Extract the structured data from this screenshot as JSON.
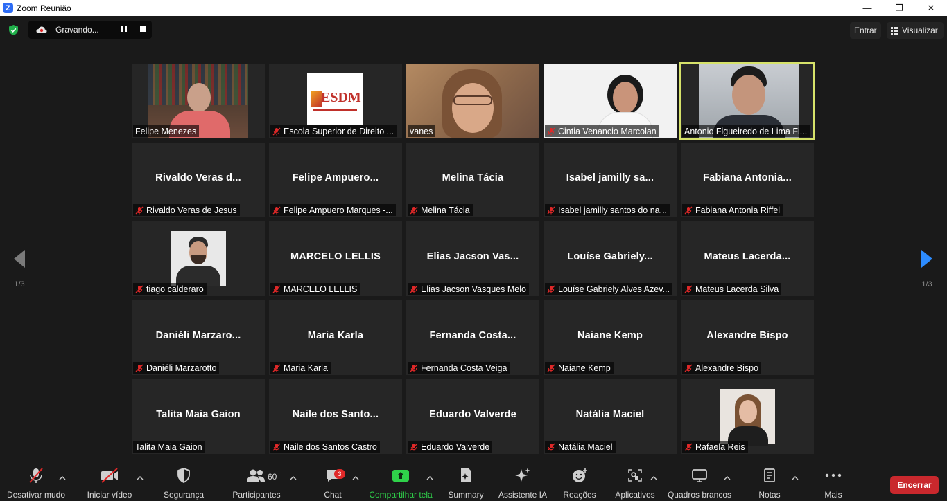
{
  "window": {
    "title": "Zoom Reunião",
    "minimize": "—",
    "restore": "❐",
    "close": "✕"
  },
  "topbar": {
    "recording_label": "Gravando...",
    "enter_label": "Entrar",
    "view_label": "Visualizar"
  },
  "pagination": {
    "left": "1/3",
    "right": "1/3"
  },
  "tiles": [
    {
      "label": "Felipe Menezes",
      "muted": false,
      "video": "felipe"
    },
    {
      "label": "Escola Superior de Direito ...",
      "muted": true,
      "video": "esdm"
    },
    {
      "label": "vanes",
      "muted": false,
      "video": "vanes"
    },
    {
      "label": "Cintia Venancio Marcolan",
      "muted": true,
      "video": "cintia"
    },
    {
      "label": "Antonio Figueiredo de Lima Fi...",
      "muted": false,
      "video": "antonio",
      "active": true
    },
    {
      "label": "Rivaldo Veras de Jesus",
      "big": "Rivaldo  Veras  d...",
      "muted": true
    },
    {
      "label": "Felipe Ampuero Marques -...",
      "big": "Felipe  Ampuero...",
      "muted": true
    },
    {
      "label": "Melina Tácia",
      "big": "Melina Tácia",
      "muted": true
    },
    {
      "label": "Isabel jamilly santos do na...",
      "big": "Isabel  jamilly  sa...",
      "muted": true
    },
    {
      "label": "Fabiana Antonia Riffel",
      "big": "Fabiana  Antonia...",
      "muted": true
    },
    {
      "label": "tiago calderaro",
      "muted": true,
      "video": "tiago"
    },
    {
      "label": "MARCELO LELLIS",
      "big": "MARCELO LELLIS",
      "muted": true
    },
    {
      "label": "Elias Jacson Vasques Melo",
      "big": "Elias  Jacson  Vas...",
      "muted": true
    },
    {
      "label": "Louíse Gabriely Alves Azev...",
      "big": "Louíse  Gabriely...",
      "muted": true
    },
    {
      "label": "Mateus Lacerda Silva",
      "big": "Mateus  Lacerda...",
      "muted": true
    },
    {
      "label": "Daniéli Marzarotto",
      "big": "Daniéli  Marzaro...",
      "muted": true
    },
    {
      "label": "Maria Karla",
      "big": "Maria Karla",
      "muted": true
    },
    {
      "label": "Fernanda Costa Veiga",
      "big": "Fernanda  Costa...",
      "muted": true
    },
    {
      "label": "Naiane Kemp",
      "big": "Naiane Kemp",
      "muted": true
    },
    {
      "label": "Alexandre Bispo",
      "big": "Alexandre Bispo",
      "muted": true
    },
    {
      "label": "Talita Maia Gaion",
      "big": "Talita Maia Gaion",
      "muted": false
    },
    {
      "label": "Naile dos Santos Castro",
      "big": "Naile  dos  Santo...",
      "muted": true
    },
    {
      "label": "Eduardo Valverde",
      "big": "Eduardo Valverde",
      "muted": true
    },
    {
      "label": "Natália Maciel",
      "big": "Natália Maciel",
      "muted": true
    },
    {
      "label": "Rafaela Reis",
      "muted": true,
      "video": "rafaela"
    }
  ],
  "esdm_logo_text": "ESDM",
  "toolbar": {
    "mute": "Desativar mudo",
    "video": "Iniciar vídeo",
    "security": "Segurança",
    "participants": "Participantes",
    "participants_count": "60",
    "chat": "Chat",
    "chat_badge": "3",
    "share": "Compartilhar tela",
    "summary": "Summary",
    "ai": "Assistente IA",
    "reactions": "Reações",
    "apps": "Aplicativos",
    "whiteboards": "Quadros brancos",
    "notes": "Notas",
    "more": "Mais",
    "end": "Encerrar"
  },
  "colors": {
    "accent_share": "#2fd24a",
    "end": "#c9282d",
    "active_speaker": "#d6e26a",
    "muted_icon": "#e02828",
    "pager_arrow_right": "#2d8cff"
  }
}
